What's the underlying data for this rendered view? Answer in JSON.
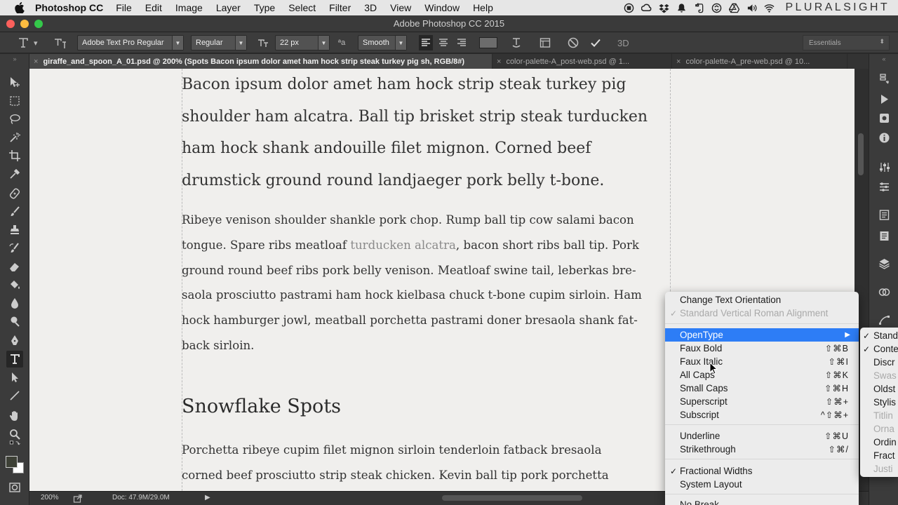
{
  "menubar": {
    "app_name": "Photoshop CC",
    "items": [
      "File",
      "Edit",
      "Image",
      "Layer",
      "Type",
      "Select",
      "Filter",
      "3D",
      "View",
      "Window",
      "Help"
    ],
    "brand": "PLURALSIGHT"
  },
  "window": {
    "title": "Adobe Photoshop CC 2015"
  },
  "options_bar": {
    "font_family": "Adobe Text Pro Regular",
    "font_style": "Regular",
    "font_size": "22 px",
    "antialias": "Smooth",
    "workspace": "Essentials"
  },
  "tabs": [
    {
      "label": "giraffe_and_spoon_A_01.psd @ 200% (Spots Bacon ipsum dolor amet ham hock strip steak turkey pig sh, RGB/8#)",
      "active": true
    },
    {
      "label": "color-palette-A_post-web.psd @ 1...",
      "active": false
    },
    {
      "label": "color-palette-A_pre-web.psd @ 10...",
      "active": false
    }
  ],
  "document": {
    "para1_lines": [
      "Bacon ipsum dolor amet ham hock strip steak turkey pig",
      "shoulder ham alcatra. Ball tip brisket strip steak turducken",
      "ham hock shank andouille filet mignon. Corned beef",
      "drumstick ground round landjaeger pork belly t-bone."
    ],
    "para2_line1": "Ribeye venison shoulder shankle pork chop. Rump ball tip cow salami bacon",
    "para2_line2_pre": "tongue. Spare ribs meatloaf ",
    "para2_line2_highlight": "turducken alcatra",
    "para2_line2_post": ", bacon short ribs ball tip. Pork",
    "para2_line3": "ground round beef ribs pork belly venison. Meatloaf swine tail, leberkas bre-",
    "para2_line4": "saola prosciutto pastrami ham hock kielbasa chuck t-bone cupim sirloin. Ham",
    "para2_line5": "hock hamburger jowl, meatball porchetta pastrami doner bresaola shank fat-",
    "para2_line6": "back sirloin.",
    "subheading": "Snowflake Spots",
    "para3_lines": [
      "Porchetta ribeye cupim filet mignon sirloin tenderloin fatback bresaola",
      "corned beef prosciutto strip steak chicken. Kevin ball tip pork porchetta"
    ]
  },
  "status_bar": {
    "zoom": "200%",
    "doc_size": "Doc: 47.9M/29.0M"
  },
  "context_menu": {
    "change_orientation": "Change Text Orientation",
    "standard_vertical": "Standard Vertical Roman Alignment",
    "opentype": "OpenType",
    "faux_bold": {
      "label": "Faux Bold",
      "shortcut": "⇧⌘B"
    },
    "faux_italic": {
      "label": "Faux Italic",
      "shortcut": "⇧⌘I"
    },
    "all_caps": {
      "label": "All Caps",
      "shortcut": "⇧⌘K"
    },
    "small_caps": {
      "label": "Small Caps",
      "shortcut": "⇧⌘H"
    },
    "superscript": {
      "label": "Superscript",
      "shortcut": "⇧⌘+"
    },
    "subscript": {
      "label": "Subscript",
      "shortcut": "^⇧⌘+"
    },
    "underline": {
      "label": "Underline",
      "shortcut": "⇧⌘U"
    },
    "strikethrough": {
      "label": "Strikethrough",
      "shortcut": "⇧⌘/"
    },
    "fractional_widths": "Fractional Widths",
    "system_layout": "System Layout",
    "no_break": "No Break"
  },
  "submenu": {
    "items": [
      "Stand",
      "Conte",
      "Discr",
      "Swas",
      "Oldst",
      "Stylis",
      "Titlin",
      "Orna",
      "Ordin",
      "Fract",
      "Justi"
    ],
    "checked": [
      0,
      1
    ],
    "disabled": [
      3,
      6,
      7,
      10
    ]
  },
  "colors": {
    "menu_highlight": "#2d7df6",
    "canvas_bg": "#f0efed",
    "chrome_dark": "#3b3b3b",
    "close_light": "#fc605c",
    "min_light": "#fdbc40",
    "max_light": "#34c84a"
  },
  "icons": {
    "menubar_status": [
      "record-icon",
      "creative-cloud-icon",
      "dropbox-icon",
      "notification-icon",
      "evernote-icon",
      "sync-icon",
      "google-drive-icon",
      "volume-icon",
      "wifi-icon"
    ]
  }
}
